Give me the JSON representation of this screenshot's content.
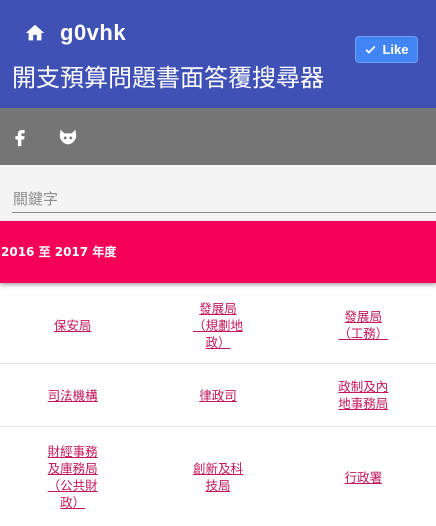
{
  "header": {
    "brand": "g0vhk",
    "title": "開支預算問題書面答覆搜尋器",
    "like_label": "Like",
    "background_color": "#3f51b5",
    "icons": {
      "home": "home-icon",
      "like": "check-icon"
    }
  },
  "social": {
    "background_color": "#757575",
    "icons": [
      "facebook-icon",
      "github-icon"
    ]
  },
  "search": {
    "placeholder": "關鍵字",
    "value": ""
  },
  "year_banner": {
    "label": "2016 至 2017 年度",
    "background_color": "#f50057"
  },
  "departments": [
    [
      "保安局",
      "發展局（規劃地政）",
      "發展局（工務）"
    ],
    [
      "司法機構",
      "律政司",
      "政制及內地事務局"
    ],
    [
      "財經事務及庫務局（公共財政）",
      "創新及科技局",
      "行政署"
    ]
  ],
  "link_color": "#c2185b"
}
